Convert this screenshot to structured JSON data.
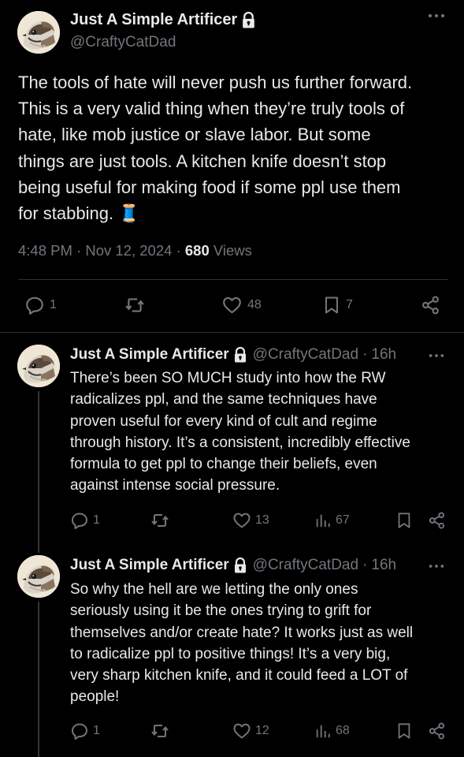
{
  "main_tweet": {
    "display_name": "Just A Simple Artificer",
    "handle": "@CraftyCatDad",
    "text_lines": [
      "The tools of hate will never push us further forward.",
      "This is a very valid thing when they’re truly tools of",
      "hate, like mob justice or slave labor. But some",
      "things are just tools. A kitchen knife doesn’t stop",
      "being useful for making food if some ppl use them",
      "for stabbing."
    ],
    "emoji": "🧵",
    "time": "4:48 PM",
    "date": "Nov 12, 2024",
    "views_count": "680",
    "views_label": "Views",
    "replies": "1",
    "likes": "48",
    "bookmarks": "7"
  },
  "replies": [
    {
      "display_name": "Just A Simple Artificer",
      "handle": "@CraftyCatDad",
      "time": "16h",
      "text_lines": [
        "There’s been SO MUCH study into how the RW",
        "radicalizes ppl, and the same techniques have",
        "proven useful for every kind of cult and regime",
        "through history. It’s a consistent, incredibly effective",
        "formula to get ppl to change their beliefs, even",
        "against intense social pressure."
      ],
      "replies": "1",
      "likes": "13",
      "views": "67"
    },
    {
      "display_name": "Just A Simple Artificer",
      "handle": "@CraftyCatDad",
      "time": "16h",
      "text_lines": [
        "So why the hell are we letting the only ones",
        "seriously using it be the ones trying to grift for",
        "themselves and/or create hate? It works just as well",
        "to radicalize ppl to positive things! It’s a very big,",
        "very sharp kitchen knife, and it could feed a LOT of",
        "people!"
      ],
      "replies": "1",
      "likes": "12",
      "views": "68"
    }
  ],
  "separator": "·",
  "icons": {
    "lock": "lock-icon",
    "more": "more-icon",
    "reply": "reply-icon",
    "retweet": "retweet-icon",
    "like": "heart-icon",
    "bookmark": "bookmark-icon",
    "share": "share-icon",
    "views": "views-icon"
  },
  "colors": {
    "background": "#000000",
    "text": "#e7e9ea",
    "secondary": "#71767b",
    "divider": "#2f3336"
  }
}
